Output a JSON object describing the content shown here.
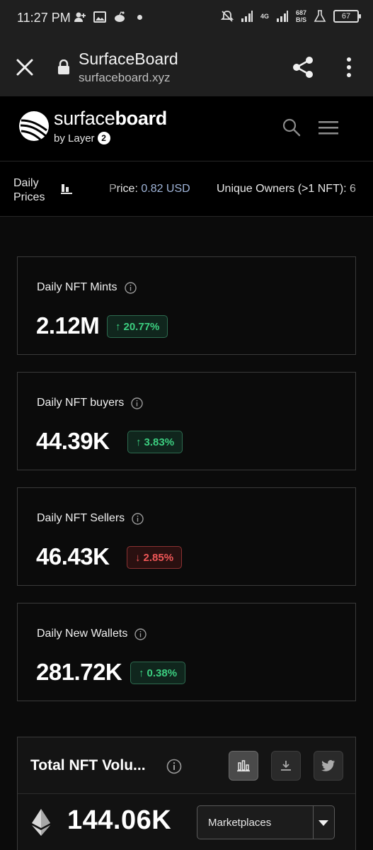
{
  "status_bar": {
    "time": "11:27 PM",
    "net_speed": "687",
    "net_unit": "B/S",
    "signal": "4G",
    "battery": "67"
  },
  "browser": {
    "title": "SurfaceBoard",
    "url": "surfaceboard.xyz"
  },
  "header": {
    "logo_light": "surface",
    "logo_bold": "board",
    "by_text": "by Layer",
    "layer_badge": "2"
  },
  "ticker": {
    "label": "Daily Prices",
    "item1_label": "Price: ",
    "item1_value": "0.82 USD",
    "item2": "Unique Owners (>1 NFT): 6"
  },
  "cards": [
    {
      "title": "Daily NFT Mints",
      "value": "2.12M",
      "change": "20.77%",
      "direction": "up"
    },
    {
      "title": "Daily NFT buyers",
      "value": "44.39K",
      "change": "3.83%",
      "direction": "up"
    },
    {
      "title": "Daily NFT Sellers",
      "value": "46.43K",
      "change": "2.85%",
      "direction": "down"
    },
    {
      "title": "Daily New Wallets",
      "value": "281.72K",
      "change": "0.38%",
      "direction": "up"
    }
  ],
  "volume": {
    "title": "Total NFT Volu...",
    "value": "144.06K",
    "select_value": "Marketplaces"
  },
  "colors": {
    "up": "#3ccf80",
    "down": "#f05757",
    "ticker_value": "#9fb4d8"
  }
}
